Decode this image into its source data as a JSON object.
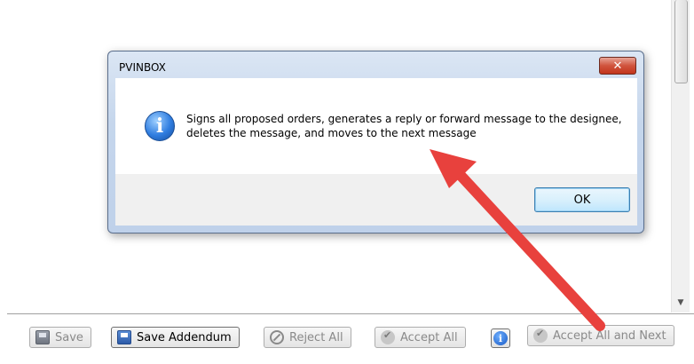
{
  "dialog": {
    "title": "PVINBOX",
    "close_glyph": "✕",
    "icon": "info-icon",
    "message": "Signs all proposed orders, generates a reply or forward message to the designee, deletes the message, and moves to the next message",
    "ok_label": "OK"
  },
  "toolbar": {
    "save_label": "Save",
    "save_addendum_label": "Save Addendum",
    "reject_all_label": "Reject All",
    "accept_all_label": "Accept All",
    "info_glyph": "i",
    "accept_all_next_label": "Accept All and Next"
  },
  "scrollbar": {
    "down_glyph": "▼"
  },
  "colors": {
    "annotation_arrow": "#e8413d",
    "close_button": "#c3351d"
  }
}
